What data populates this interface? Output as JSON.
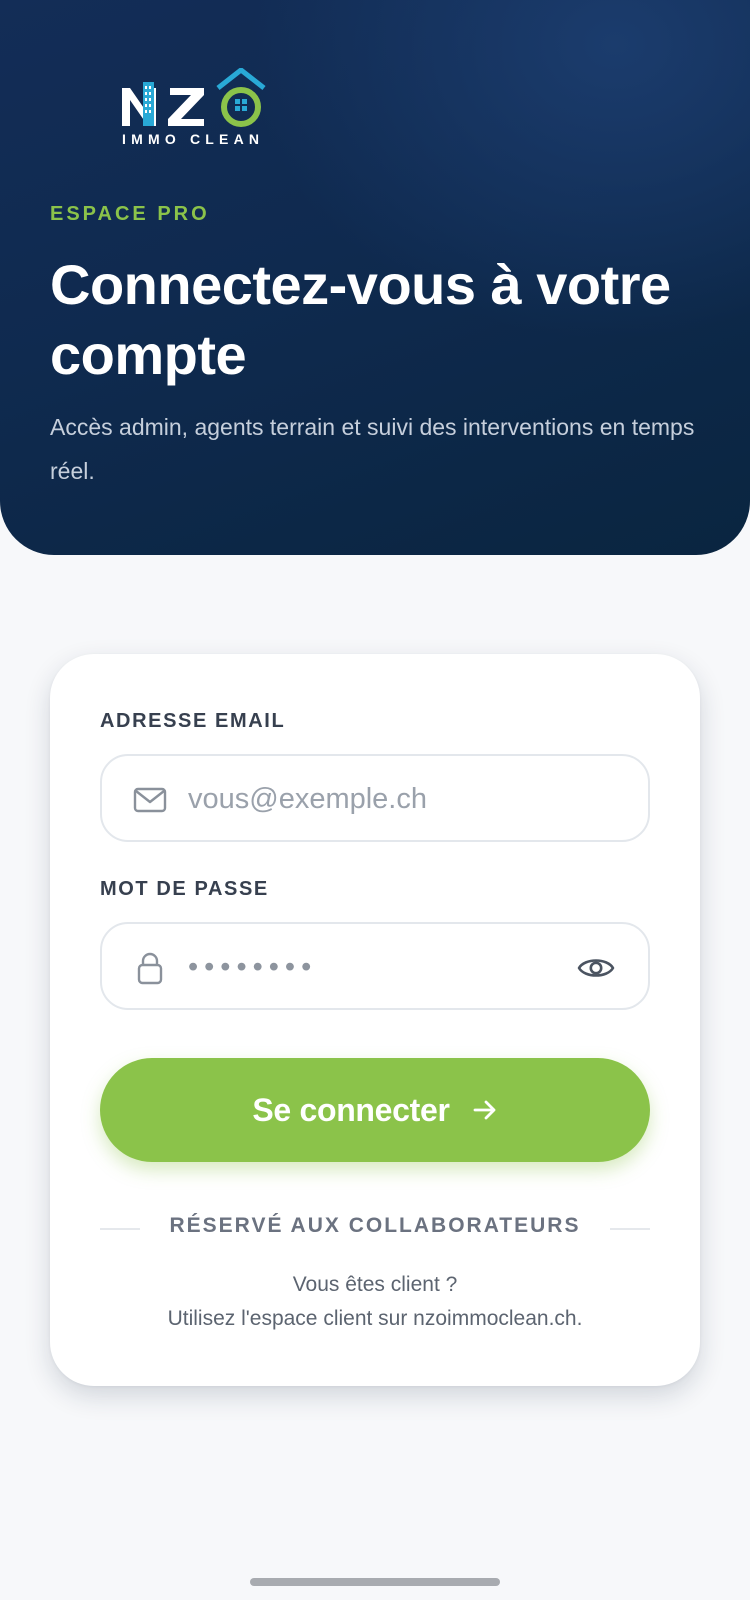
{
  "brand": {
    "logo_text": "NZO",
    "logo_subtitle": "IMMO CLEAN",
    "accent_color": "#8bc34a",
    "secondary_color": "#29a9d6",
    "header_color": "#0f2a4f"
  },
  "header": {
    "eyebrow": "ESPACE PRO",
    "title": "Connectez-vous à votre compte",
    "subtitle": "Accès admin, agents terrain et suivi des interventions en temps réel."
  },
  "form": {
    "email": {
      "label": "ADRESSE EMAIL",
      "placeholder": "vous@exemple.ch",
      "icon": "mail-icon"
    },
    "password": {
      "label": "MOT DE PASSE",
      "placeholder": "••••••••",
      "icon": "lock-icon",
      "toggle_icon": "eye-icon"
    },
    "submit_label": "Se connecter",
    "submit_icon": "arrow-right-icon"
  },
  "footer": {
    "divider_text": "RÉSERVÉ AUX COLLABORATEURS",
    "note_line1": "Vous êtes client ?",
    "note_line2": "Utilisez l'espace client sur nzoimmoclean.ch."
  }
}
